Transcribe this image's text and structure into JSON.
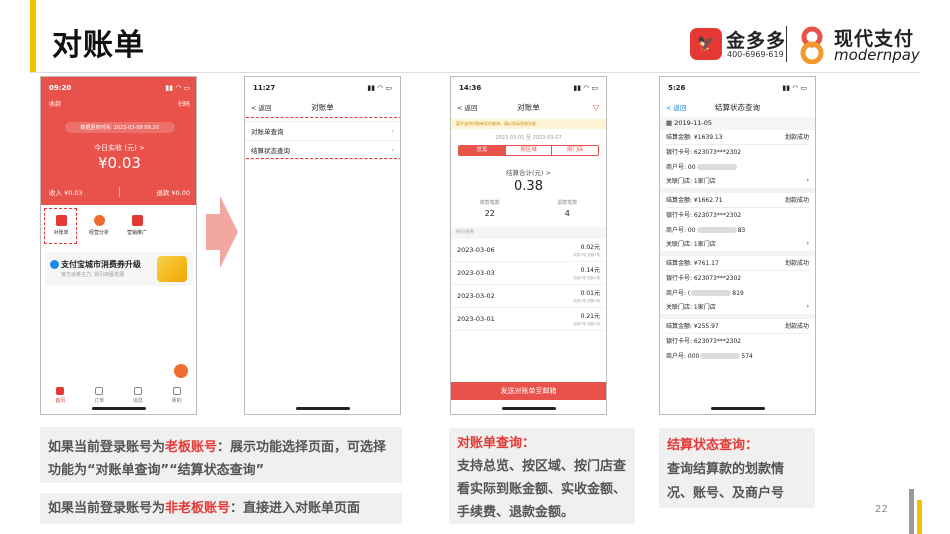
{
  "title": "对账单",
  "logos": {
    "jdd_name": "金多多",
    "jdd_phone": "400-6969-619",
    "mp_cn": "现代支付",
    "mp_en": "modernpay"
  },
  "phone1": {
    "time": "09:20",
    "nav_left": "收款",
    "nav_right": "扫码",
    "data_time": "数据更新时间: 2023-03-08 09:20",
    "label": "今日实收 (元) >",
    "amount": "¥0.03",
    "income": "收入 ¥0.03",
    "refund": "退款 ¥0.00",
    "icons": [
      "对账单",
      "经营分析",
      "营销推广"
    ],
    "banner_title": "支付宝城市消费券升级",
    "banner_sub": "官方派券主力, 领引商圈发展",
    "tabs": [
      "首页",
      "订单",
      "消息",
      "我的"
    ]
  },
  "phone2": {
    "time": "11:27",
    "back": "< 返回",
    "title": "对账单",
    "items": [
      "对账单查询",
      "结算状态查询"
    ]
  },
  "phone3": {
    "time": "14:36",
    "back": "< 返回",
    "title": "对账单",
    "notice": "暂不支持对账单实时查询，请以实际到账为准",
    "date_range": "2023-03-01  至  2023-03-07",
    "segments": [
      "总览",
      "按区域",
      "按门店"
    ],
    "sum_label": "结算合计(元) >",
    "sum": "0.38",
    "count_label": "收款笔数",
    "count": "22",
    "refund_label": "退款笔数",
    "refund_count": "4",
    "section": "按日查看",
    "rows": [
      {
        "date": "2023-03-06",
        "amt": "0.02元",
        "sub": "收款2笔 退款1笔"
      },
      {
        "date": "2023-03-03",
        "amt": "0.14元",
        "sub": "收款5笔 退款1笔"
      },
      {
        "date": "2023-03-02",
        "amt": "0.01元",
        "sub": "收款1笔 退款0笔"
      },
      {
        "date": "2023-03-01",
        "amt": "0.21元",
        "sub": "收款9笔 退款2笔"
      }
    ],
    "button": "发送对账单至邮箱"
  },
  "phone4": {
    "time": "5:26",
    "back": "< 返回",
    "title": "结算状态查询",
    "date": "2019-11-05",
    "blocks": [
      {
        "amount": "结算金额: ¥1639.13",
        "status": "划款成功",
        "card": "银行卡号: 623073***2302",
        "merchant": "商户号: 00",
        "merchant_tail": "",
        "store": "关联门店: 1家门店"
      },
      {
        "amount": "结算金额: ¥1662.71",
        "status": "划款成功",
        "card": "银行卡号: 623073***2302",
        "merchant": "商户号: 00",
        "merchant_tail": "83",
        "store": "关联门店: 1家门店"
      },
      {
        "amount": "结算金额: ¥761.17",
        "status": "划款成功",
        "card": "银行卡号: 623073***2302",
        "merchant": "商户号: (",
        "merchant_tail": "819",
        "store": "关联门店: 1家门店"
      },
      {
        "amount": "结算金额: ¥255.97",
        "status": "划款成功",
        "card": "银行卡号: 623073***2302",
        "merchant": "商户号: 000",
        "merchant_tail": "574",
        "store": ""
      }
    ]
  },
  "notes": {
    "n1_pre": "如果当前登录账号为",
    "n1_hl": "老板账号",
    "n1_post": "：展示功能选择页面，可选择功能为“对账单查询”“结算状态查询”",
    "n2_pre": "如果当前登录账号为",
    "n2_hl": "非老板账号",
    "n2_post": "：直接进入对账单页面",
    "n3_head": "对账单查询：",
    "n3_body": "支持总览、按区域、按门店查看实际到账金额、实收金额、手续费、退款金额。",
    "n4_head": "结算状态查询：",
    "n4_body": "查询结算款的划款情况、账号、及商户号"
  },
  "page_number": "22",
  "colors": {
    "accent": "#e9524a",
    "brand_yellow": "#f2c200"
  }
}
